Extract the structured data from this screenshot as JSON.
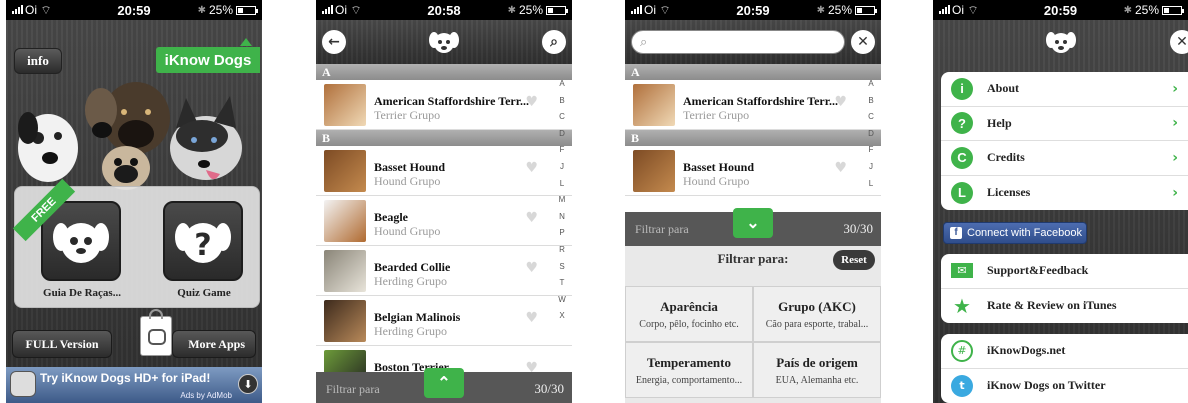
{
  "status": {
    "carrier": "Oi",
    "battery": "25%",
    "times": [
      "20:59",
      "20:58",
      "20:59",
      "20:59"
    ]
  },
  "home": {
    "info_label": "info",
    "brand": "iKnow Dogs",
    "free_ribbon": "FREE",
    "tile_breeds_label": "Guia De Raças...",
    "tile_quiz_label": "Quiz Game",
    "full_version_label": "FULL Version",
    "more_apps_label": "More Apps",
    "ad_text": "Try iKnow Dogs HD+ for iPad!",
    "ad_by": "Ads by AdMob"
  },
  "list": {
    "sections": [
      {
        "letter": "A",
        "rows": [
          {
            "name": "American Staffordshire Terr...",
            "group": "Terrier Grupo"
          }
        ]
      },
      {
        "letter": "B",
        "rows": [
          {
            "name": "Basset Hound",
            "group": "Hound Grupo"
          },
          {
            "name": "Beagle",
            "group": "Hound Grupo"
          },
          {
            "name": "Bearded Collie",
            "group": "Herding Grupo"
          },
          {
            "name": "Belgian Malinois",
            "group": "Herding Grupo"
          },
          {
            "name": "Boston Terrier",
            "group": ""
          }
        ]
      }
    ],
    "index_letters": [
      "A",
      "B",
      "C",
      "D",
      "F",
      "J",
      "L",
      "M",
      "N",
      "P",
      "R",
      "S",
      "T",
      "W",
      "X"
    ],
    "filter_label": "Filtrar para",
    "filter_count": "30/30"
  },
  "filter": {
    "search_placeholder": "",
    "panel_title": "Filtrar para:",
    "reset_label": "Reset",
    "cells": [
      {
        "title": "Aparência",
        "sub": "Corpo, pêlo, focinho etc."
      },
      {
        "title": "Grupo (AKC)",
        "sub": "Cão para esporte, trabal..."
      },
      {
        "title": "Temperamento",
        "sub": "Energia, comportamento..."
      },
      {
        "title": "País de origem",
        "sub": "EUA, Alemanha etc."
      }
    ]
  },
  "settings": {
    "group1": [
      {
        "label": "About",
        "icon": "i"
      },
      {
        "label": "Help",
        "icon": "?"
      },
      {
        "label": "Credits",
        "icon": "C"
      },
      {
        "label": "Licenses",
        "icon": "L"
      }
    ],
    "facebook_label": "Connect with Facebook",
    "group2": [
      {
        "label": "Support&Feedback"
      },
      {
        "label": "Rate & Review on iTunes"
      }
    ],
    "group3": [
      {
        "label": "iKnowDogs.net"
      },
      {
        "label": "iKnow Dogs on Twitter"
      }
    ]
  },
  "colors": {
    "accent": "#3fb34a",
    "facebook": "#3b5998"
  }
}
